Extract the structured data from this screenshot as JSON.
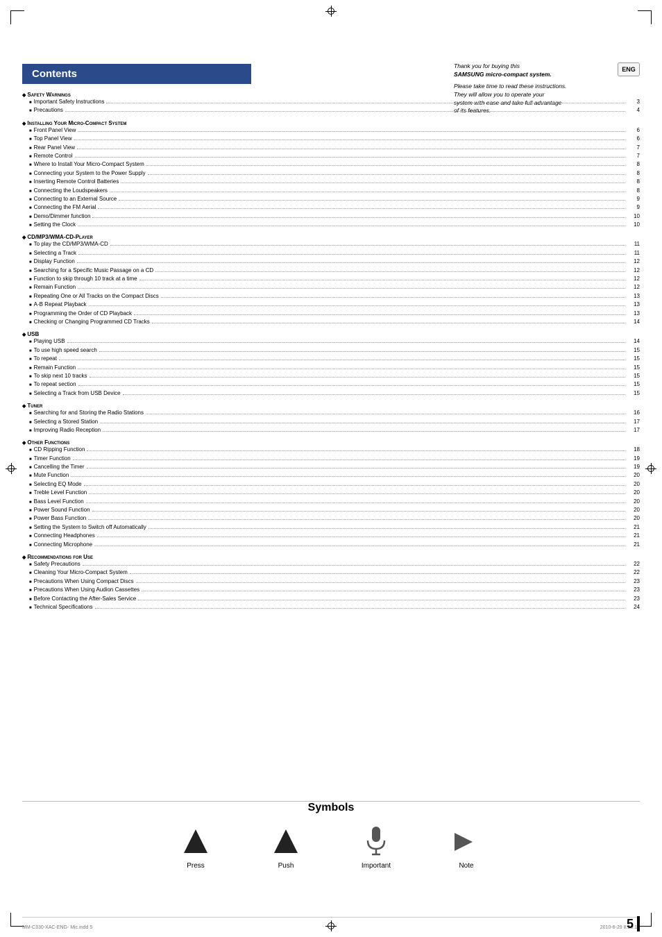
{
  "page": {
    "number": "5",
    "background": "#ffffff"
  },
  "eng_badge": "ENG",
  "thankyou": {
    "line1": "Thank you for buying this",
    "line2": "SAMSUNG micro-compact system.",
    "line3": "Please take time to read these instructions.",
    "line4": "They will allow you to operate your",
    "line5": "system with ease and take full advantage",
    "line6": "of its features."
  },
  "contents_title": "Contents",
  "toc": {
    "sections": [
      {
        "header": "Safety Warnings",
        "items": [
          {
            "text": "Important Safety Instructions",
            "page": "3"
          },
          {
            "text": "Precautions",
            "page": "4"
          }
        ]
      },
      {
        "header": "Installing Your Micro-Compact System",
        "items": [
          {
            "text": "Front Panel View",
            "page": "6"
          },
          {
            "text": "Top Panel View",
            "page": "6"
          },
          {
            "text": "Rear Panel View",
            "page": "7"
          },
          {
            "text": "Remote Control",
            "page": "7"
          },
          {
            "text": "Where to Install Your Micro-Compact System",
            "page": "8"
          },
          {
            "text": "Connecting your System to the Power Supply",
            "page": "8"
          },
          {
            "text": "Inserting Remote Control Batteries",
            "page": "8"
          },
          {
            "text": "Connecting the Loudspeakers",
            "page": "8"
          },
          {
            "text": "Connecting to an External Source",
            "page": "9"
          },
          {
            "text": "Connecting the FM Aerial",
            "page": "9"
          },
          {
            "text": "Demo/Dimmer function",
            "page": "10"
          },
          {
            "text": "Setting the Clock",
            "page": "10"
          }
        ]
      },
      {
        "header": "CD/MP3/WMA-CD-Player",
        "items": [
          {
            "text": "To play the CD/MP3/WMA-CD",
            "page": "11"
          },
          {
            "text": "Selecting a Track",
            "page": "11"
          },
          {
            "text": "Display Function",
            "page": "12"
          },
          {
            "text": "Searching for a Specific Music Passage on a CD",
            "page": "12"
          },
          {
            "text": "Function to skip through 10 track at a time",
            "page": "12"
          },
          {
            "text": "Remain Function",
            "page": "12"
          },
          {
            "text": "Repeating One or All Tracks on the Compact Discs",
            "page": "13"
          },
          {
            "text": "A-B Repeat Playback",
            "page": "13"
          },
          {
            "text": "Programming the Order of CD Playback",
            "page": "13"
          },
          {
            "text": "Checking or Changing Programmed CD Tracks",
            "page": "14"
          }
        ]
      },
      {
        "header": "USB",
        "items": [
          {
            "text": "Playing USB",
            "page": "14"
          },
          {
            "text": "To use high speed search",
            "page": "15"
          },
          {
            "text": "To repeat",
            "page": "15"
          },
          {
            "text": "Remain Function",
            "page": "15"
          },
          {
            "text": "To skip next 10 tracks",
            "page": "15"
          },
          {
            "text": "To repeat section",
            "page": "15"
          },
          {
            "text": "Selecting a Track from USB Device",
            "page": "15"
          }
        ]
      },
      {
        "header": "Tuner",
        "items": [
          {
            "text": "Searching for and Storing the Radio Stations",
            "page": "16"
          },
          {
            "text": "Selecting a Stored Station",
            "page": "17"
          },
          {
            "text": "Improving Radio Reception",
            "page": "17"
          }
        ]
      },
      {
        "header": "Other Functions",
        "items": [
          {
            "text": "CD Ripping Function",
            "page": "18"
          },
          {
            "text": "Timer Function",
            "page": "19"
          },
          {
            "text": "Cancelling the Timer",
            "page": "19"
          },
          {
            "text": "Mute Function",
            "page": "20"
          },
          {
            "text": "Selecting EQ  Mode",
            "page": "20"
          },
          {
            "text": "Treble Level Function",
            "page": "20"
          },
          {
            "text": "Bass Level Function",
            "page": "20"
          },
          {
            "text": "Power Sound Function",
            "page": "20"
          },
          {
            "text": "Power Bass Function",
            "page": "20"
          },
          {
            "text": "Setting the System to Switch off Automatically",
            "page": "21"
          },
          {
            "text": "Connecting Headphones",
            "page": "21"
          },
          {
            "text": "Connecting Microphone",
            "page": "21"
          }
        ]
      },
      {
        "header": "Recommendations for Use",
        "items": [
          {
            "text": "Safety Precautions",
            "page": "22"
          },
          {
            "text": "Cleaning Your Micro-Compact System",
            "page": "22"
          },
          {
            "text": "Precautions When Using Compact Discs",
            "page": "23"
          },
          {
            "text": "Precautions When Using Audion Cassettes",
            "page": "23"
          },
          {
            "text": "Before Contacting the After-Sales Service",
            "page": "23"
          },
          {
            "text": "Technical Specifications",
            "page": "24"
          }
        ]
      }
    ]
  },
  "symbols": {
    "title": "Symbols",
    "items": [
      {
        "label": "Press",
        "icon": "press-triangle"
      },
      {
        "label": "Push",
        "icon": "push-triangle"
      },
      {
        "label": "Important",
        "icon": "important-mic"
      },
      {
        "label": "Note",
        "icon": "note-chevron"
      }
    ]
  },
  "footer": {
    "filename": "MM-C330-XAC-ENG- Mic.indd   5",
    "date": "2010-6-29   8:36:14"
  }
}
